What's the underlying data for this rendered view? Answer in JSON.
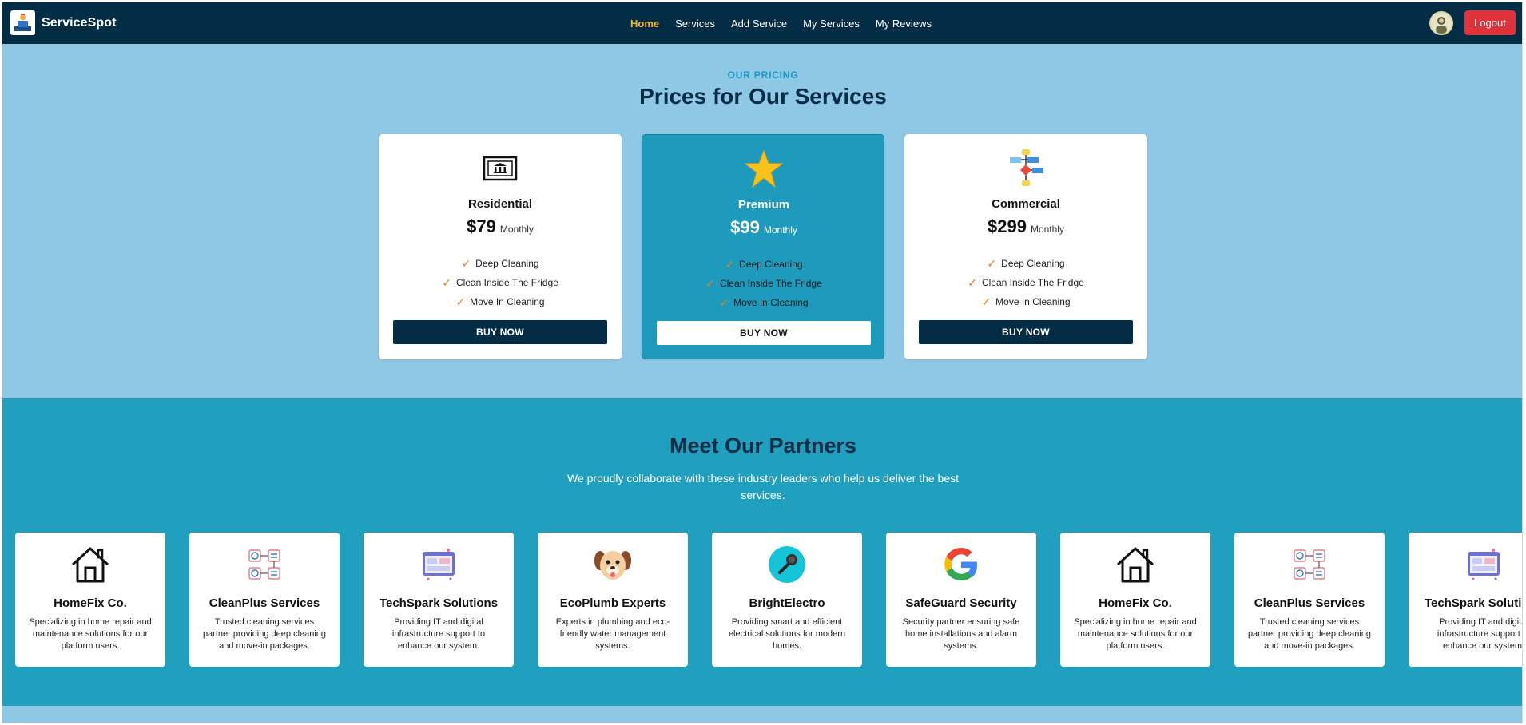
{
  "nav": {
    "brand": "ServiceSpot",
    "links": [
      {
        "label": "Home",
        "active": true
      },
      {
        "label": "Services",
        "active": false
      },
      {
        "label": "Add Service",
        "active": false
      },
      {
        "label": "My Services",
        "active": false
      },
      {
        "label": "My Reviews",
        "active": false
      }
    ],
    "logout": "Logout"
  },
  "pricing": {
    "eyebrow": "OUR PRICING",
    "title": "Prices for Our Services",
    "plans": [
      {
        "icon": "bank-icon",
        "name": "Residential",
        "price": "$79",
        "period": "Monthly",
        "features": [
          "Deep Cleaning",
          "Clean Inside The Fridge",
          "Move In Cleaning"
        ],
        "button": "BUY NOW",
        "featured": false
      },
      {
        "icon": "star-icon",
        "name": "Premium",
        "price": "$99",
        "period": "Monthly",
        "features": [
          "Deep Cleaning",
          "Clean Inside The Fridge",
          "Move In Cleaning"
        ],
        "button": "BUY NOW",
        "featured": true
      },
      {
        "icon": "flowchart-icon",
        "name": "Commercial",
        "price": "$299",
        "period": "Monthly",
        "features": [
          "Deep Cleaning",
          "Clean Inside The Fridge",
          "Move In Cleaning"
        ],
        "button": "BUY NOW",
        "featured": false
      }
    ]
  },
  "partners": {
    "title": "Meet Our Partners",
    "subtitle": "We proudly collaborate with these industry leaders who help us deliver the best services.",
    "items": [
      {
        "icon": "house-icon",
        "name": "HomeFix Co.",
        "desc": "Specializing in home repair and maintenance solutions for our platform users."
      },
      {
        "icon": "workflow-icon",
        "name": "CleanPlus Services",
        "desc": "Trusted cleaning services partner providing deep cleaning and move-in packages."
      },
      {
        "icon": "dashboard-icon",
        "name": "TechSpark Solutions",
        "desc": "Providing IT and digital infrastructure support to enhance our system."
      },
      {
        "icon": "dog-icon",
        "name": "EcoPlumb Experts",
        "desc": "Experts in plumbing and eco-friendly water management systems."
      },
      {
        "icon": "microphone-icon",
        "name": "BrightElectro",
        "desc": "Providing smart and efficient electrical solutions for modern homes."
      },
      {
        "icon": "google-icon",
        "name": "SafeGuard Security",
        "desc": "Security partner ensuring safe home installations and alarm systems."
      },
      {
        "icon": "house-icon",
        "name": "HomeFix Co.",
        "desc": "Specializing in home repair and maintenance solutions for our platform users."
      },
      {
        "icon": "workflow-icon",
        "name": "CleanPlus Services",
        "desc": "Trusted cleaning services partner providing deep cleaning and move-in packages."
      },
      {
        "icon": "dashboard-icon",
        "name": "TechSpark Solutions",
        "desc": "Providing IT and digital infrastructure support to enhance our system."
      }
    ]
  },
  "colors": {
    "nav_bg": "#032c45",
    "active_link": "#f4b321",
    "logout_bg": "#e0323a",
    "pricing_bg": "#8fc8e5",
    "accent_teal": "#219fbf",
    "checkmark": "#f07c1a"
  }
}
